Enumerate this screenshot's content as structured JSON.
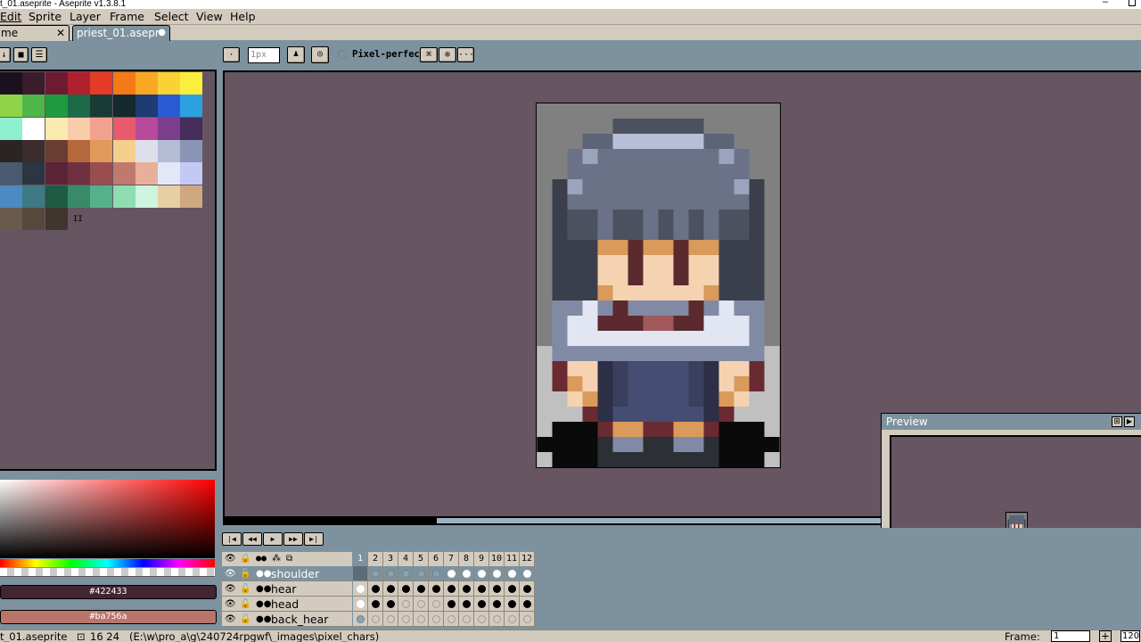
{
  "window": {
    "title": "t_01.aseprite - Aseprite v1.3.8.1",
    "minimize": "–"
  },
  "menu": [
    "Edit",
    "Sprite",
    "Layer",
    "Frame",
    "Select",
    "View",
    "Help"
  ],
  "tabs": [
    {
      "label": "me",
      "close": "✕"
    },
    {
      "label": "priest_01.asepr",
      "close": "●"
    }
  ],
  "toolbar": {
    "brush_size_value": "1px",
    "pixel_perfect_label": "Pixel-perfect",
    "more": "···"
  },
  "palette": {
    "rows": [
      [
        "#1b1220",
        "#3a1c2b",
        "#6e1a33",
        "#b0202e",
        "#e33b25",
        "#f47a17",
        "#f9a826",
        "#f9d233",
        "#fbee3c"
      ],
      [
        "#8fd448",
        "#4fb64a",
        "#1f9b3f",
        "#1c6a48",
        "#1a3a36",
        "#142a2c",
        "#1e3b73",
        "#2b5bd4",
        "#2ca0e0"
      ],
      [
        "#8ef0cf",
        "#ffffff",
        "#fbeab0",
        "#f6ccaa",
        "#f2a28e",
        "#e65c6c",
        "#b84a9c",
        "#7b3e8c",
        "#452e5a"
      ],
      [
        "#2a2423",
        "#3b2d2b",
        "#6a3d32",
        "#b5683c",
        "#e19a5a",
        "#f5cf8c",
        "#dde0ea",
        "#b6bcd6",
        "#8a95b6"
      ],
      [
        "#4a5a6e",
        "#2c3541",
        "#5a2436",
        "#6f3140",
        "#9a4d50",
        "#c07a6d",
        "#e8b09a",
        "#e2e8f8",
        "#c4c8f4"
      ],
      [
        "#4b8ac2",
        "#3d7a84",
        "#1f5a44",
        "#3a8a6a",
        "#55b08c",
        "#8edcb0",
        "#cff4e0",
        "#e6cfa2",
        "#cfa880"
      ],
      [
        "#6a5a4c",
        "#55493e",
        "#403630"
      ]
    ],
    "extra_mark": "II"
  },
  "colors": {
    "foreground_hex": "#422433",
    "background_hex": "#ba756a"
  },
  "timeline": {
    "frames": [
      "1",
      "2",
      "3",
      "4",
      "5",
      "6",
      "7",
      "8",
      "9",
      "10",
      "11",
      "12"
    ],
    "layers": [
      {
        "name": "shoulder",
        "selected": true,
        "cels": [
          "sel",
          "blue",
          "blue",
          "blue",
          "blue",
          "blue",
          "white",
          "white",
          "white",
          "white",
          "white",
          "white"
        ]
      },
      {
        "name": "hear",
        "selected": false,
        "cels": [
          "white",
          "full",
          "full",
          "full",
          "full",
          "full",
          "full",
          "full",
          "full",
          "full",
          "full",
          "full"
        ]
      },
      {
        "name": "head",
        "selected": false,
        "cels": [
          "white",
          "full",
          "full",
          "empty",
          "empty",
          "empty",
          "full",
          "full",
          "full",
          "full",
          "full",
          "full"
        ]
      },
      {
        "name": "back_hear",
        "selected": false,
        "cels": [
          "blue",
          "empty",
          "empty",
          "empty",
          "empty",
          "empty",
          "empty",
          "empty",
          "empty",
          "empty",
          "empty",
          "empty"
        ]
      }
    ]
  },
  "preview": {
    "title": "Preview"
  },
  "status": {
    "file": "t_01.aseprite",
    "size": "16 24",
    "path": "(E:\\w\\pro_a\\g\\240724rpgwf\\_images\\pixel_chars)",
    "frame_label": "Frame:",
    "frame_value": "1",
    "zoom": "120"
  }
}
